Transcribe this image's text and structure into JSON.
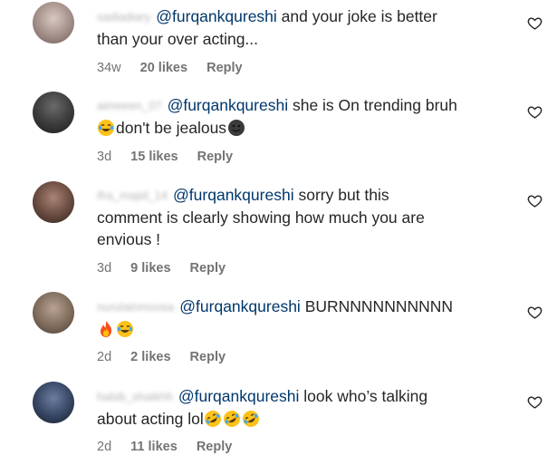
{
  "comments": [
    {
      "username": "sadiadiary",
      "mention": "@furqankqureshi",
      "line1": " and your joke is better",
      "line2": "than your over acting...",
      "time": "34w",
      "likes": "20 likes",
      "reply": "Reply",
      "avatar_colors": [
        "#c9b8b2",
        "#7d6a66"
      ]
    },
    {
      "username": "aimeeen_07",
      "mention": "@furqankqureshi",
      "line1": " she is On trending bruh",
      "line2": "don't be jealous",
      "emojis": [
        "laughing-tears",
        "smirk-dark"
      ],
      "time": "3d",
      "likes": "15 likes",
      "reply": "Reply",
      "avatar_colors": [
        "#5a5a5a",
        "#2a2a2a"
      ]
    },
    {
      "username": "ifra_majid_14",
      "mention": "@furqankqureshi",
      "line1": " sorry but this",
      "line2": "comment is clearly showing how much you are",
      "line3": "envious !",
      "time": "3d",
      "likes": "9 likes",
      "reply": "Reply",
      "avatar_colors": [
        "#8a6a5c",
        "#3b2b26"
      ]
    },
    {
      "username": "nurulainmoosa",
      "mention": "@furqankqureshi",
      "line1": " BURNNNNNNNNNN",
      "emojis": [
        "fire",
        "laughing-tears"
      ],
      "time": "2d",
      "likes": "2 likes",
      "reply": "Reply",
      "avatar_colors": [
        "#a08a7c",
        "#5a4a40"
      ]
    },
    {
      "username": "habib_shaikhh",
      "mention": "@furqankqureshi",
      "line1": " look who’s talking",
      "line2": "about acting lol",
      "emojis": [
        "rofl",
        "rofl",
        "rofl"
      ],
      "time": "2d",
      "likes": "11 likes",
      "reply": "Reply",
      "avatar_colors": [
        "#4a5a7a",
        "#1e2636"
      ]
    }
  ],
  "icons": {
    "like": "heart-outline-icon"
  },
  "colors": {
    "mention": "#00376b",
    "meta": "#737373",
    "text": "#262626"
  }
}
